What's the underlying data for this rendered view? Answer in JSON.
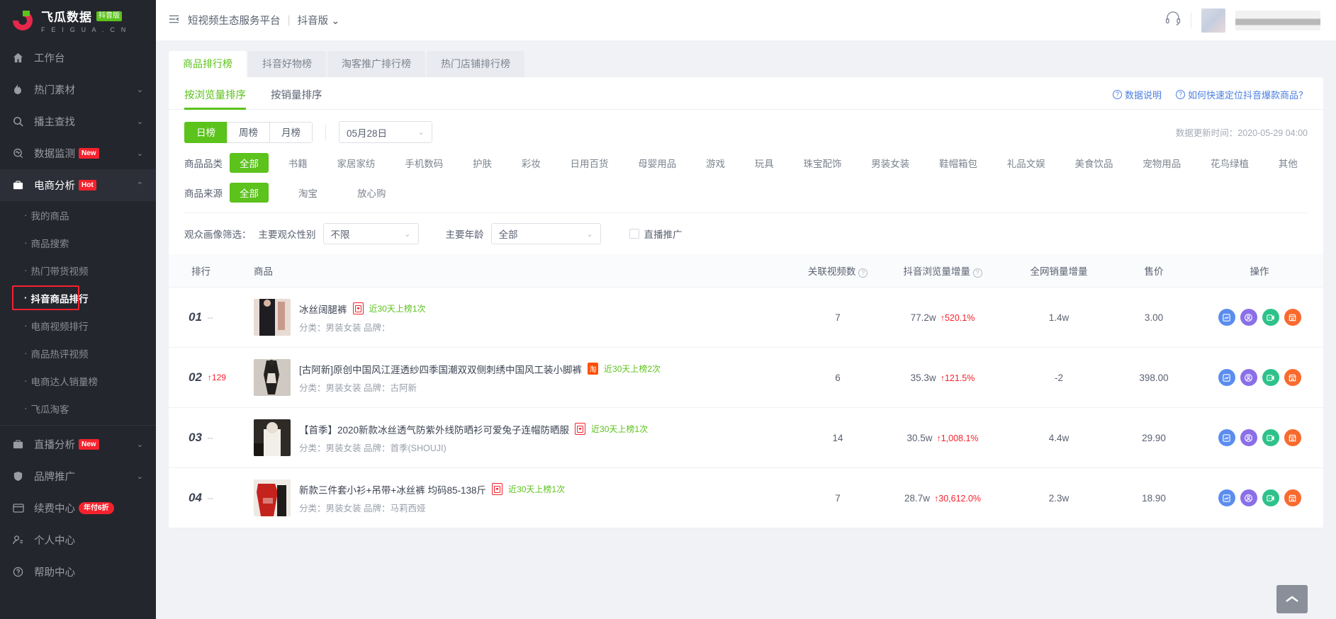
{
  "brand": {
    "name": "飞瓜数据",
    "badge": "抖音版",
    "sub": "F E I G U A . C N"
  },
  "sidebar": {
    "items": [
      {
        "label": "工作台",
        "icon": "home-icon",
        "chevron": "",
        "tag": ""
      },
      {
        "label": "热门素材",
        "icon": "fire-icon",
        "chevron": "⌄",
        "tag": ""
      },
      {
        "label": "播主查找",
        "icon": "search-icon",
        "chevron": "⌄",
        "tag": ""
      },
      {
        "label": "数据监测",
        "icon": "monitor-icon",
        "chevron": "⌄",
        "tag": "New"
      },
      {
        "label": "电商分析",
        "icon": "briefcase-icon",
        "chevron": "⌃",
        "tag": "Hot"
      }
    ],
    "submenu": [
      {
        "label": "我的商品"
      },
      {
        "label": "商品搜索"
      },
      {
        "label": "热门带货视频"
      },
      {
        "label": "抖音商品排行"
      },
      {
        "label": "电商视频排行"
      },
      {
        "label": "商品热评视频"
      },
      {
        "label": "电商达人销量榜"
      },
      {
        "label": "飞瓜淘客"
      }
    ],
    "bottom": [
      {
        "label": "直播分析",
        "icon": "live-icon",
        "chevron": "⌄",
        "tag": "New"
      },
      {
        "label": "品牌推广",
        "icon": "shield-icon",
        "chevron": "⌄",
        "tag": ""
      },
      {
        "label": "续费中心",
        "icon": "card-icon",
        "chevron": "",
        "tag": "年付6折"
      },
      {
        "label": "个人中心",
        "icon": "user-icon",
        "chevron": "",
        "tag": ""
      },
      {
        "label": "帮助中心",
        "icon": "help-icon",
        "chevron": "",
        "tag": ""
      }
    ]
  },
  "topbar": {
    "title": "短视频生态服务平台",
    "separator": "|",
    "version": "抖音版",
    "version_chevron": "⌄"
  },
  "tabs": [
    {
      "label": "商品排行榜"
    },
    {
      "label": "抖音好物榜"
    },
    {
      "label": "淘客推广排行榜"
    },
    {
      "label": "热门店铺排行榜"
    }
  ],
  "subtabs": [
    {
      "label": "按浏览量排序"
    },
    {
      "label": "按销量排序"
    }
  ],
  "helper_links": [
    {
      "label": "数据说明"
    },
    {
      "label": "如何快速定位抖音爆款商品？"
    }
  ],
  "period": {
    "options": [
      "日榜",
      "周榜",
      "月榜"
    ],
    "selected": "日榜",
    "date_value": "05月28日",
    "chevron": "⌄"
  },
  "update_time": "数据更新时间：2020-05-29 04:00",
  "category_filter": {
    "label": "商品品类",
    "options": [
      "全部",
      "书籍",
      "家居家纺",
      "手机数码",
      "护肤",
      "彩妆",
      "日用百货",
      "母婴用品",
      "游戏",
      "玩具",
      "珠宝配饰",
      "男装女装",
      "鞋帽箱包",
      "礼品文娱",
      "美食饮品",
      "宠物用品",
      "花鸟绿植",
      "其他"
    ],
    "selected": "全部"
  },
  "source_filter": {
    "label": "商品来源",
    "options": [
      "全部",
      "淘宝",
      "放心购"
    ],
    "selected": "全部"
  },
  "audience_filter": {
    "label": "观众画像筛选：",
    "gender_label": "主要观众性别",
    "gender_value": "不限",
    "age_label": "主要年龄",
    "age_value": "全部",
    "checkbox_label": "直播推广",
    "chevron": "⌄"
  },
  "table": {
    "headers": [
      {
        "key": "rank",
        "label": "排行",
        "help": false
      },
      {
        "key": "product",
        "label": "商品",
        "help": false
      },
      {
        "key": "videos",
        "label": "关联视频数",
        "help": true
      },
      {
        "key": "views",
        "label": "抖音浏览量增量",
        "help": true
      },
      {
        "key": "sales",
        "label": "全网销量增量",
        "help": false
      },
      {
        "key": "price",
        "label": "售价",
        "help": false
      },
      {
        "key": "ops",
        "label": "操作",
        "help": false
      }
    ],
    "rows": [
      {
        "rank": "01",
        "delta": "--",
        "delta_up": false,
        "title": "冰丝阔腿裤",
        "badge": "red",
        "badge_text": "",
        "onlist": "近30天上榜1次",
        "category": "分类：男装女装 品牌：",
        "videos": "7",
        "views": "77.2w",
        "views_pct": "↑520.1%",
        "sales": "1.4w",
        "price": "3.00",
        "thumb": "#2c2c30"
      },
      {
        "rank": "02",
        "delta": "↑129",
        "delta_up": true,
        "title": "[古阿新]原创中国风江涯透纱四季国潮双双侧刺绣中国风工装小脚裤",
        "badge": "tao",
        "badge_text": "淘",
        "onlist": "近30天上榜2次",
        "category": "分类：男装女装 品牌：古阿新",
        "videos": "6",
        "views": "35.3w",
        "views_pct": "↑121.5%",
        "sales": "-2",
        "price": "398.00",
        "thumb": "#cfcac4"
      },
      {
        "rank": "03",
        "delta": "--",
        "delta_up": false,
        "title": "【首季】2020新款冰丝透气防紫外线防晒衫可爱兔子连帽防晒服",
        "badge": "red",
        "badge_text": "",
        "onlist": "近30天上榜1次",
        "category": "分类：男装女装 品牌：首季(SHOUJI)",
        "videos": "14",
        "views": "30.5w",
        "views_pct": "↑1,008.1%",
        "sales": "4.4w",
        "price": "29.90",
        "thumb": "#3a3530"
      },
      {
        "rank": "04",
        "delta": "--",
        "delta_up": false,
        "title": "新款三件套小衫+吊带+冰丝裤 均码85-138斤",
        "badge": "red",
        "badge_text": "",
        "onlist": "近30天上榜1次",
        "category": "分类：男装女装 品牌：马莉西娅",
        "videos": "7",
        "views": "28.7w",
        "views_pct": "↑30,612.0%",
        "sales": "2.3w",
        "price": "18.90",
        "thumb": "#c23a2c"
      }
    ],
    "action_buttons": [
      {
        "name": "trend-chart-icon",
        "color": "#5b8def"
      },
      {
        "name": "author-icon",
        "color": "#8a6fe8"
      },
      {
        "name": "video-icon",
        "color": "#2ec28b"
      },
      {
        "name": "shop-icon",
        "color": "#f96a2e"
      }
    ]
  },
  "back_to_top": "⌃"
}
